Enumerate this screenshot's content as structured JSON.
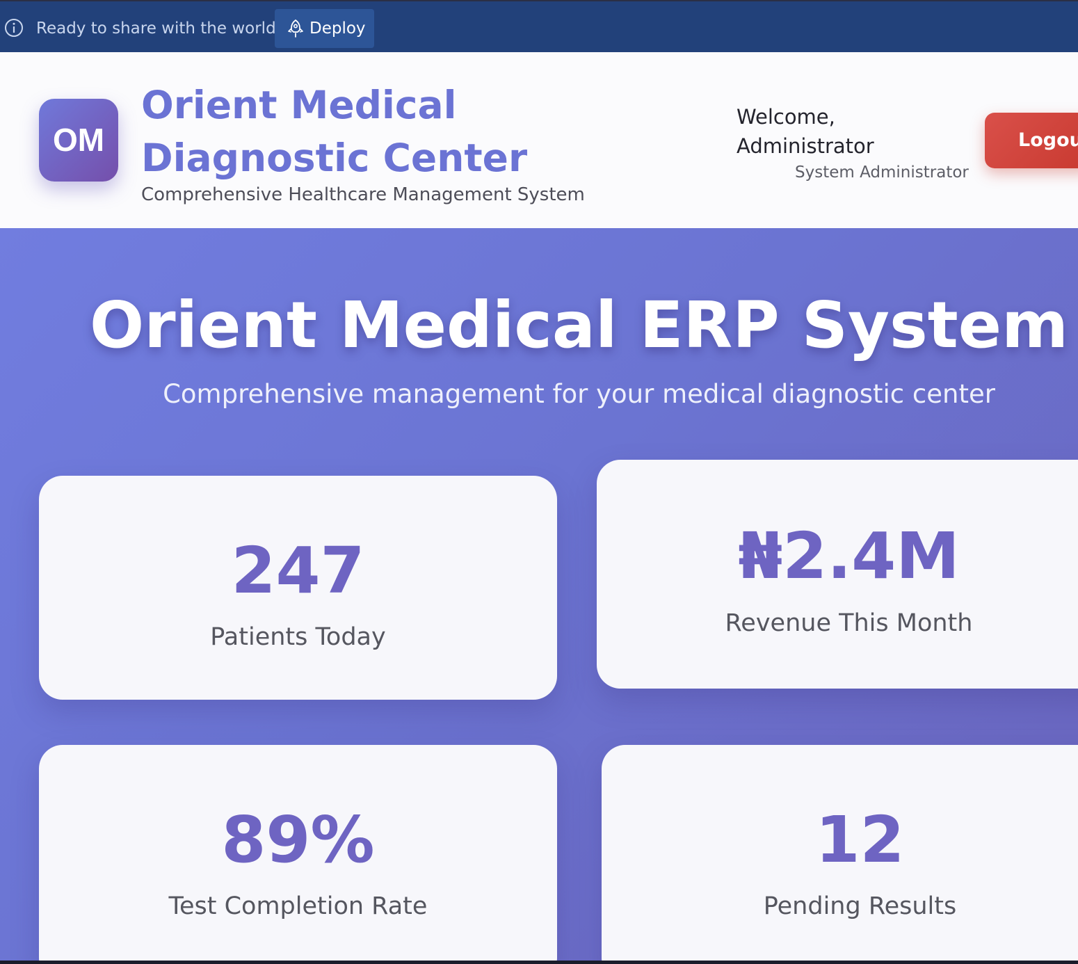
{
  "deploy_bar": {
    "message": "Ready to share with the world?",
    "button_label": "Deploy",
    "info_icon": "info-icon",
    "button_icon": "rocket-icon"
  },
  "header": {
    "logo_text": "OM",
    "title": "Orient Medical Diagnostic Center",
    "subtitle": "Comprehensive Healthcare Management System",
    "welcome": "Welcome, Administrator",
    "role": "System Administrator",
    "logout_label": "Logout"
  },
  "hero": {
    "title": "Orient Medical ERP System",
    "subtitle": "Comprehensive management for your medical diagnostic center"
  },
  "stats": [
    {
      "value": "247",
      "label": "Patients Today"
    },
    {
      "value": "₦2.4M",
      "label": "Revenue This Month"
    },
    {
      "value": "89%",
      "label": "Test Completion Rate"
    },
    {
      "value": "12",
      "label": "Pending Results"
    }
  ],
  "colors": {
    "deploy_bar": "#22417a",
    "brand_accent": "#6b73d4",
    "logout": "#d04a41",
    "hero_gradient_start": "#717ddf",
    "hero_gradient_end": "#6a64bc",
    "stat_value": "#6e64c2"
  }
}
